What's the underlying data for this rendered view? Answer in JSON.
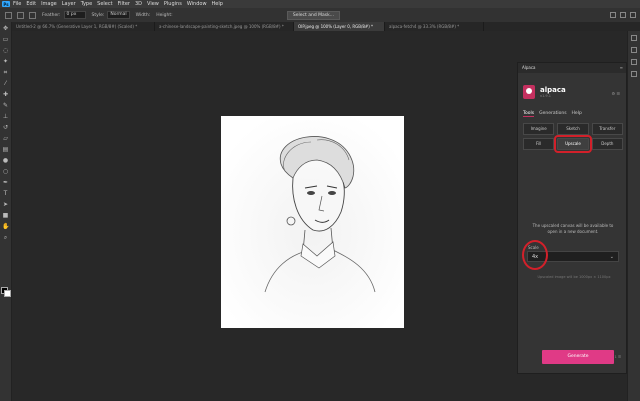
{
  "menubar": {
    "logo": "Ps",
    "items": [
      "File",
      "Edit",
      "Image",
      "Layer",
      "Type",
      "Select",
      "Filter",
      "3D",
      "View",
      "Plugins",
      "Window",
      "Help"
    ]
  },
  "options": {
    "feather_label": "Feather:",
    "feather_value": "0 px",
    "style_label": "Style:",
    "style_value": "Normal",
    "width_label": "Width:",
    "height_label": "Height:",
    "select_mask": "Select and Mask..."
  },
  "tabs": [
    "Untitled-2 @ 66.7% (Generative Layer 1, RGB/8#) (Scaled) *",
    "a-chinese-landscape-painting-sketch.jpeg @ 100% (RGB/8#) *",
    "OIP.jpeg @ 100% (Layer 0, RGB/8#) *",
    "alpaca-fetch4 @ 33.3% (RGB/8#) *"
  ],
  "panel": {
    "tab_label": "Alpaca",
    "brand_name": "alpaca",
    "brand_sub": "v1.9.1",
    "brand_icons": "⚙ ☰",
    "nav": [
      "Tools",
      "Generations",
      "Help"
    ],
    "buttons": [
      "Imagine",
      "Sketch",
      "Transfer",
      "Fill",
      "Upscale",
      "Depth"
    ],
    "info": "The upscaled canvas will be available to open in a new document.",
    "scale_label": "Scale",
    "scale_value": "4x",
    "note": "Upscaled image will be 1000px × 1100px",
    "generate": "Generate",
    "gen_count": "1 ☰"
  },
  "colors": {
    "accent": "#e03a86",
    "highlight": "#d2202a",
    "ps_blue": "#31a8ff"
  },
  "icons": [
    "move-icon",
    "marquee-icon",
    "lasso-icon",
    "magic-wand-icon",
    "crop-icon",
    "eyedropper-icon",
    "healing-icon",
    "brush-icon",
    "stamp-icon",
    "history-brush-icon",
    "eraser-icon",
    "gradient-icon",
    "blur-icon",
    "dodge-icon",
    "pen-icon",
    "type-icon",
    "path-select-icon",
    "shape-icon",
    "hand-icon",
    "zoom-icon"
  ]
}
